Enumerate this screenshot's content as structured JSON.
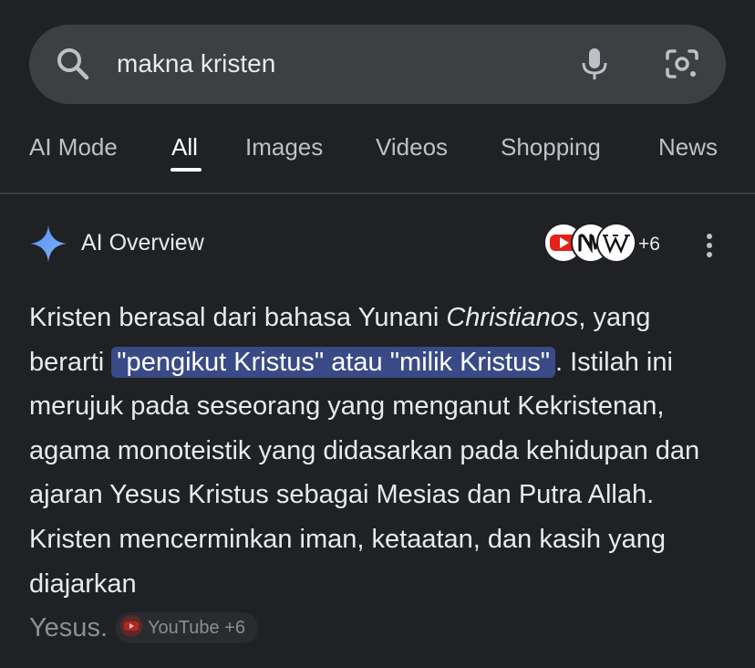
{
  "search": {
    "query": "makna kristen"
  },
  "tabs": [
    {
      "label": "AI Mode",
      "active": false
    },
    {
      "label": "All",
      "active": true
    },
    {
      "label": "Images",
      "active": false
    },
    {
      "label": "Videos",
      "active": false
    },
    {
      "label": "Shopping",
      "active": false
    },
    {
      "label": "News",
      "active": false
    }
  ],
  "ai_overview": {
    "title": "AI Overview",
    "sources_more": "+6",
    "text": {
      "p1": "Kristen berasal dari bahasa Yunani ",
      "p1_italic": "Christianos",
      "p2": ", yang berarti ",
      "highlight": "\"pengikut Kristus\" atau \"milik Kristus\"",
      "p3": ". Istilah ini merujuk pada seseorang yang menganut Kekristenan, agama monoteistik yang didasarkan pada kehidupan dan ajaran Yesus Kristus sebagai Mesias dan Putra Allah. Kristen mencerminkan iman, ketaatan, dan kasih yang diajarkan",
      "fade": "Yesus."
    },
    "citation_chip": "YouTube +6"
  },
  "colors": {
    "background": "#202124",
    "searchbar": "#3c4043",
    "highlight": "#394a86",
    "sparkle": "#4d8ff7"
  }
}
